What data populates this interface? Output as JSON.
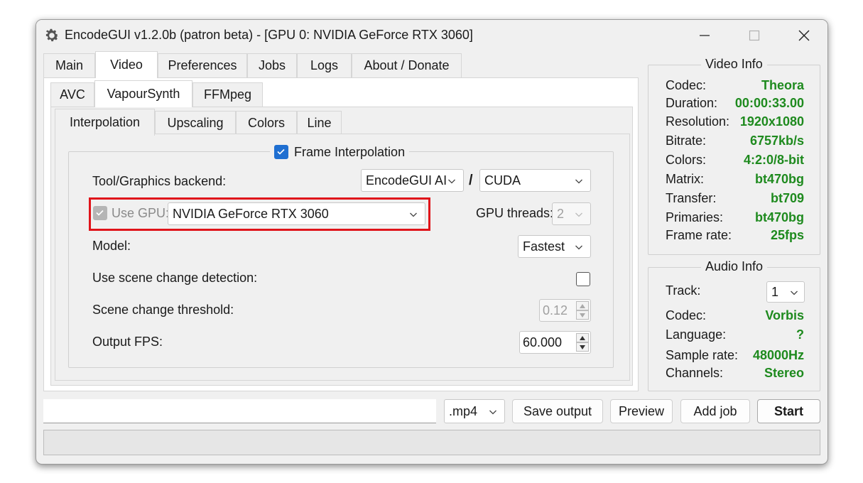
{
  "window": {
    "title": "EncodeGUI v1.2.0b (patron beta) - [GPU 0: NVIDIA GeForce RTX 3060]",
    "app_icon": "gear-icon",
    "controls": {
      "minimize": "minimize-icon",
      "maximize": "maximize-icon",
      "close": "close-icon"
    }
  },
  "main_tabs": [
    "Main",
    "Video",
    "Preferences",
    "Jobs",
    "Logs",
    "About / Donate"
  ],
  "main_tab_active": "Video",
  "video_tabs": [
    "AVC",
    "VapourSynth",
    "FFMpeg"
  ],
  "video_tab_active": "VapourSynth",
  "vs_tabs": [
    "Interpolation",
    "Upscaling",
    "Colors",
    "Line"
  ],
  "vs_tab_active": "Interpolation",
  "interpolation": {
    "group_title": "Frame Interpolation",
    "group_enabled": true,
    "backend_label": "Tool/Graphics backend:",
    "backend_tool": "EncodeGUI AI",
    "backend_separator": "/",
    "backend_api": "CUDA",
    "use_gpu_label": "Use GPU:",
    "use_gpu_checked": true,
    "gpu_device": "NVIDIA GeForce RTX 3060",
    "gpu_threads_label": "GPU threads:",
    "gpu_threads": "2",
    "model_label": "Model:",
    "model": "Fastest",
    "scene_detect_label": "Use scene change detection:",
    "scene_detect_checked": false,
    "scene_threshold_label": "Scene change threshold:",
    "scene_threshold": "0.12",
    "output_fps_label": "Output FPS:",
    "output_fps": "60.000"
  },
  "video_info": {
    "title": "Video Info",
    "rows": [
      {
        "key": "Codec:",
        "value": "Theora"
      },
      {
        "key": "Duration:",
        "value": "00:00:33.00"
      },
      {
        "key": "Resolution:",
        "value": "1920x1080"
      },
      {
        "key": "Bitrate:",
        "value": "6757kb/s"
      },
      {
        "key": "Colors:",
        "value": "4:2:0/8-bit"
      },
      {
        "key": "Matrix:",
        "value": "bt470bg"
      },
      {
        "key": "Transfer:",
        "value": "bt709"
      },
      {
        "key": "Primaries:",
        "value": "bt470bg"
      },
      {
        "key": "Frame rate:",
        "value": "25fps"
      }
    ]
  },
  "audio_info": {
    "title": "Audio Info",
    "track_label": "Track:",
    "track": "1",
    "rows": [
      {
        "key": "Codec:",
        "value": "Vorbis"
      },
      {
        "key": "Language:",
        "value": "?"
      },
      {
        "key": "Sample rate:",
        "value": "48000Hz"
      },
      {
        "key": "Channels:",
        "value": "Stereo"
      }
    ]
  },
  "bottom": {
    "output_path": "",
    "container": ".mp4",
    "save_output": "Save output",
    "preview": "Preview",
    "add_job": "Add job",
    "start": "Start",
    "status": ""
  },
  "colors": {
    "accent": "#1f6fd1",
    "info_value": "#1e8a1e",
    "highlight": "#e0141a"
  }
}
